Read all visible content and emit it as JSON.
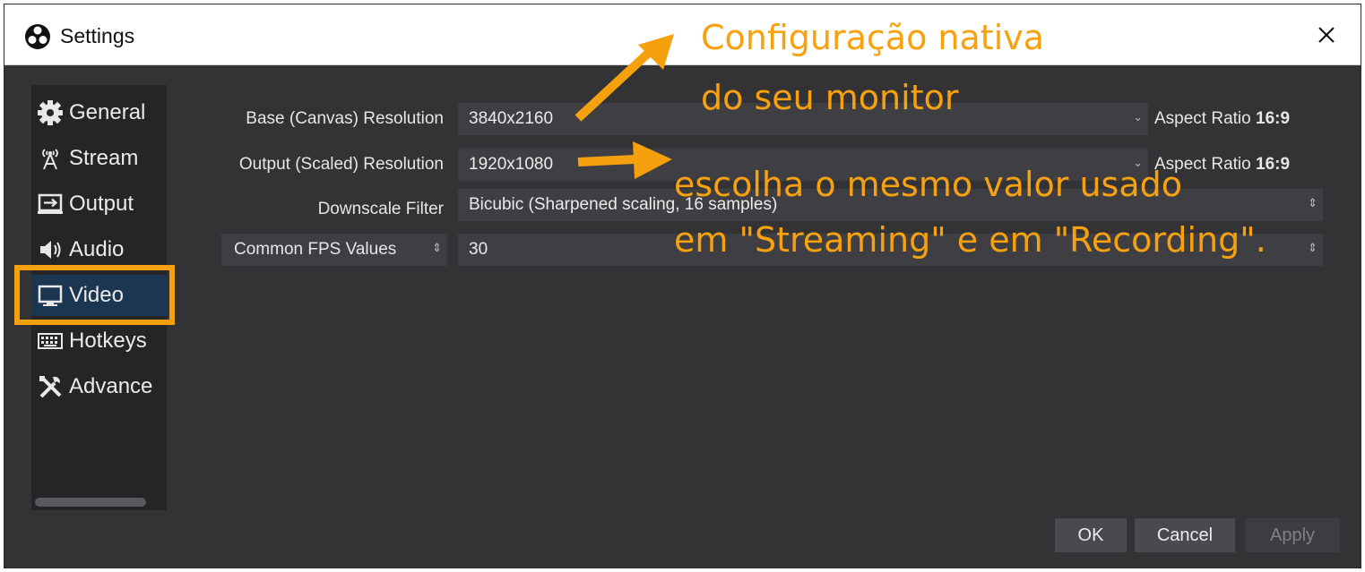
{
  "window": {
    "title": "Settings",
    "close_icon": "close-icon"
  },
  "sidebar": {
    "items": [
      {
        "label": "General",
        "icon": "gear-icon"
      },
      {
        "label": "Stream",
        "icon": "antenna-icon"
      },
      {
        "label": "Output",
        "icon": "output-icon"
      },
      {
        "label": "Audio",
        "icon": "speaker-icon"
      },
      {
        "label": "Video",
        "icon": "monitor-icon",
        "selected": true
      },
      {
        "label": "Hotkeys",
        "icon": "keyboard-icon"
      },
      {
        "label": "Advance",
        "icon": "tools-icon"
      }
    ]
  },
  "video": {
    "base_label": "Base (Canvas) Resolution",
    "base_value": "3840x2160",
    "base_aspect_label": "Aspect Ratio",
    "base_aspect_value": "16:9",
    "output_label": "Output (Scaled) Resolution",
    "output_value": "1920x1080",
    "output_aspect_label": "Aspect Ratio",
    "output_aspect_value": "16:9",
    "downscale_label": "Downscale Filter",
    "downscale_value": "Bicubic (Sharpened scaling, 16 samples)",
    "fps_type": "Common FPS Values",
    "fps_value": "30"
  },
  "buttons": {
    "ok": "OK",
    "cancel": "Cancel",
    "apply": "Apply"
  },
  "annotations": {
    "line1": "Configuração nativa",
    "line2": "do seu monitor",
    "line3": "escolha o mesmo valor usado",
    "line4": "em \"Streaming\" e em \"Recording\"."
  },
  "colors": {
    "accent": "#f5a10e",
    "background": "#333336",
    "selected": "#1b3651"
  }
}
